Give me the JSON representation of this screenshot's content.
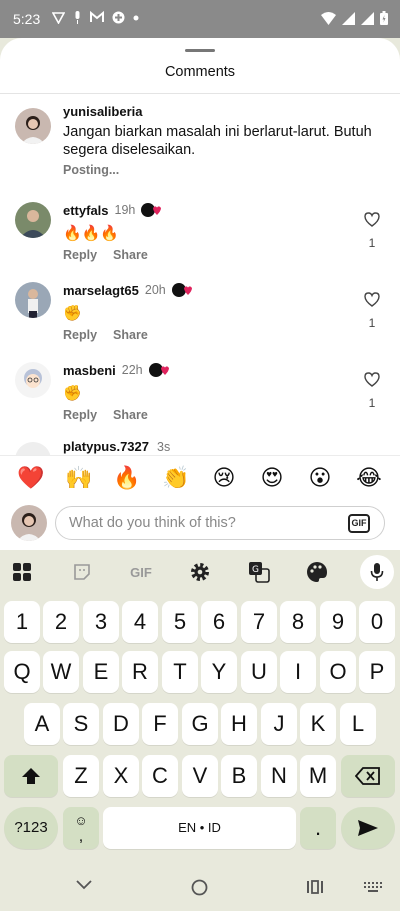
{
  "status": {
    "time": "5:23"
  },
  "sheet": {
    "title": "Comments",
    "caption": {
      "username": "yunisaliberia",
      "text": "Jangan biarkan masalah ini berlarut-larut. Butuh segera diselesaikan.",
      "status": "Posting..."
    },
    "comments": [
      {
        "username": "ettyfals",
        "time": "19h",
        "text": "🔥🔥🔥",
        "reply": "Reply",
        "share": "Share",
        "likes": "1"
      },
      {
        "username": "marselagt65",
        "time": "20h",
        "text": "✊",
        "reply": "Reply",
        "share": "Share",
        "likes": "1"
      },
      {
        "username": "masbeni",
        "time": "22h",
        "text": "✊",
        "reply": "Reply",
        "share": "Share",
        "likes": "1"
      }
    ],
    "partial_comment": {
      "username": "platypus.7327",
      "time": "3s"
    }
  },
  "emoji_bar": [
    "❤️",
    "🙌",
    "🔥",
    "👏",
    "😢",
    "😍",
    "😮",
    "😂"
  ],
  "composer": {
    "placeholder": "What do you think of this?",
    "gif": "GIF"
  },
  "keyboard": {
    "toolbar_gif": "GIF",
    "row_numbers": [
      "1",
      "2",
      "3",
      "4",
      "5",
      "6",
      "7",
      "8",
      "9",
      "0"
    ],
    "row_q": [
      "Q",
      "W",
      "E",
      "R",
      "T",
      "Y",
      "U",
      "I",
      "O",
      "P"
    ],
    "row_a": [
      "A",
      "S",
      "D",
      "F",
      "G",
      "H",
      "J",
      "K",
      "L"
    ],
    "row_z": [
      "Z",
      "X",
      "C",
      "V",
      "B",
      "N",
      "M"
    ],
    "sym_key": "?123",
    "comma_key": ",",
    "space_label": "EN • ID",
    "period_key": "."
  },
  "colors": {
    "accent": "#d4dfc4",
    "keyboard_bg": "#e8e9dc",
    "heart": "#e0245e"
  }
}
